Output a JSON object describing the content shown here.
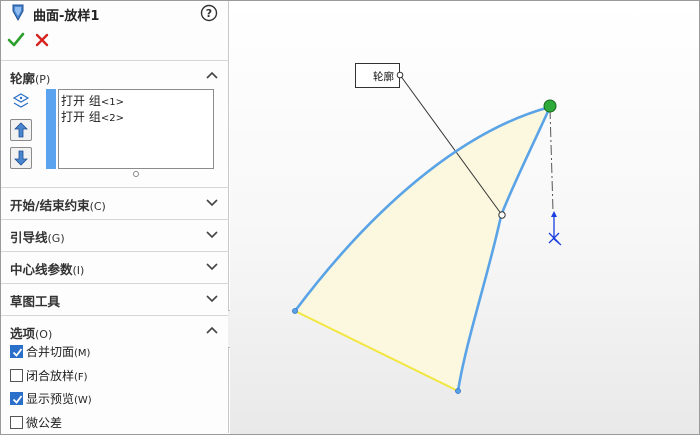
{
  "feature": {
    "title": "曲面-放样1",
    "icon": "loft-surface-icon"
  },
  "actions": {
    "ok": "check-icon",
    "cancel": "x-icon"
  },
  "sections": {
    "profile": {
      "title": "轮廓",
      "key": "(P)",
      "state": "expanded"
    },
    "start_end": {
      "title": "开始/结束约束",
      "key": "(C)",
      "state": "collapsed"
    },
    "guides": {
      "title": "引导线",
      "key": "(G)",
      "state": "collapsed"
    },
    "centerline": {
      "title": "中心线参数",
      "key": "(I)",
      "state": "collapsed"
    },
    "sketch_tools": {
      "title": "草图工具",
      "key": "",
      "state": "collapsed"
    },
    "options": {
      "title": "选项",
      "key": "(O)",
      "state": "expanded"
    }
  },
  "profile_list": [
    {
      "name": "打开 组",
      "index": "<1>"
    },
    {
      "name": "打开 组",
      "index": "<2>"
    }
  ],
  "options": [
    {
      "label": "合并切面",
      "key": "(M)",
      "checked": true
    },
    {
      "label": "闭合放样",
      "key": "(F)",
      "checked": false
    },
    {
      "label": "显示预览",
      "key": "(W)",
      "checked": true
    },
    {
      "label": "微公差",
      "key": "",
      "checked": false
    }
  ],
  "viewport": {
    "callout_label": "轮廓",
    "colors": {
      "edge": "#5aa3e6",
      "surface_fill": "#fbf8df",
      "bottom_edge": "#f2e640",
      "endpoint": "#2eaa3a",
      "triad": "#1a3ee0"
    }
  },
  "colors": {
    "accent": "#2a6fc9",
    "strip": "#5ba3ee",
    "ok": "#2ca02c",
    "cancel": "#d62222"
  }
}
